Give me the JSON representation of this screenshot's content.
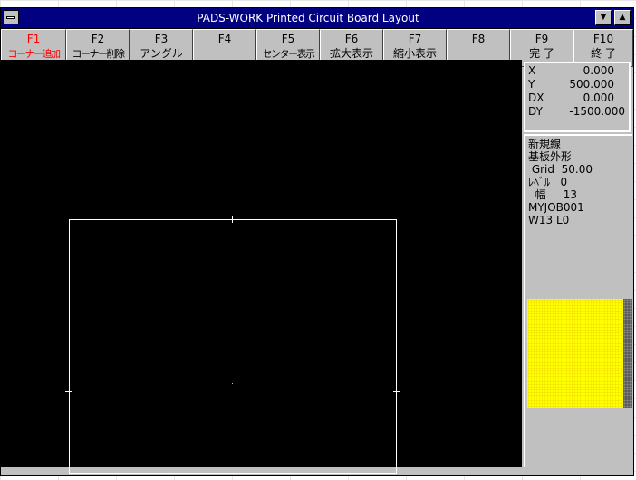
{
  "window": {
    "title": "PADS-WORK Printed Circuit Board Layout",
    "minimize_glyph": "▼",
    "maximize_glyph": "▲"
  },
  "function_keys": [
    {
      "key": "F1",
      "label": "コーナー追加",
      "active": true
    },
    {
      "key": "F2",
      "label": "コーナー削除"
    },
    {
      "key": "F3",
      "label": "アングル"
    },
    {
      "key": "F4",
      "label": ""
    },
    {
      "key": "F5",
      "label": "センター表示"
    },
    {
      "key": "F6",
      "label": "拡大表示"
    },
    {
      "key": "F7",
      "label": "縮小表示"
    },
    {
      "key": "F8",
      "label": ""
    },
    {
      "key": "F9",
      "label": "完 了"
    },
    {
      "key": "F10",
      "label": "終 了"
    }
  ],
  "coordinates": {
    "x_label": "X",
    "x_value": "0.000",
    "y_label": "Y",
    "y_value": "500.000",
    "dx_label": "DX",
    "dx_value": "0.000",
    "dy_label": "DY",
    "dy_value": "-1500.000"
  },
  "info": {
    "mode": "新規線",
    "object": "基板外形",
    "grid": " Grid  50.00",
    "level": "ﾚﾍﾞﾙ   0",
    "width": "  幅     13",
    "job": "MYJOB001",
    "status": "W13 L0"
  },
  "colors": {
    "titlebar": "#000080",
    "canvas": "#000000",
    "outline": "#ffffff",
    "active_key_text": "#ff0000",
    "layer_swatch": "#ffff00"
  }
}
